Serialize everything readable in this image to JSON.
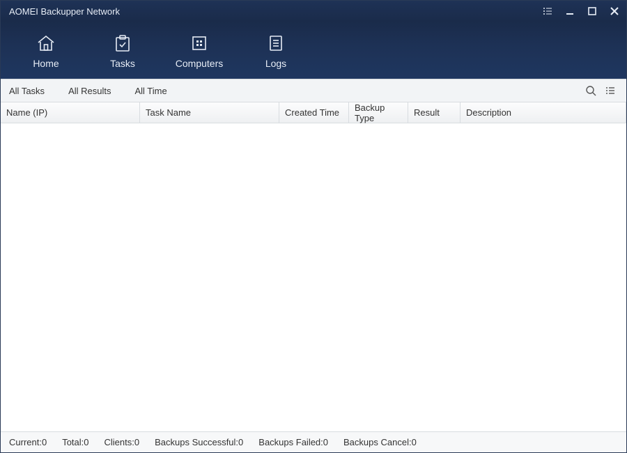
{
  "title": "AOMEI Backupper Network",
  "nav": {
    "home": "Home",
    "tasks": "Tasks",
    "computers": "Computers",
    "logs": "Logs"
  },
  "filters": {
    "all_tasks": "All Tasks",
    "all_results": "All Results",
    "all_time": "All Time"
  },
  "columns": {
    "name": "Name (IP)",
    "task": "Task Name",
    "created": "Created Time",
    "btype": "Backup Type",
    "result": "Result",
    "desc": "Description"
  },
  "status": {
    "current": "Current:0",
    "total": "Total:0",
    "clients": "Clients:0",
    "success": "Backups Successful:0",
    "failed": "Backups Failed:0",
    "cancel": "Backups Cancel:0"
  }
}
